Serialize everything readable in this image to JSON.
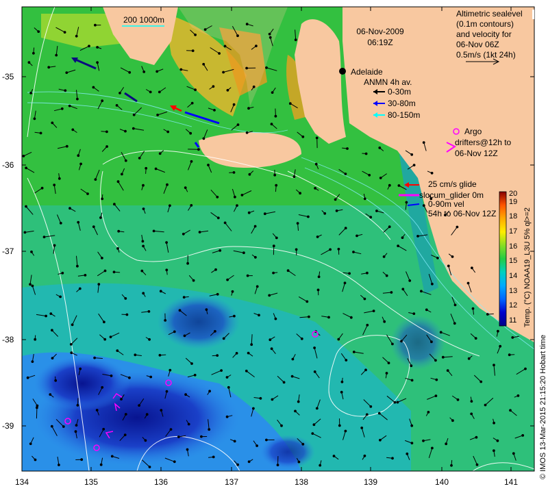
{
  "date_title": "06-Nov-2009",
  "time_title": "06:19Z",
  "city": "Adelaide",
  "scale_text": "200  1000m",
  "altimetric_legend": [
    "Altimetric sealevel",
    "(0.1m contours)",
    "and velocity for",
    "06-Nov 06Z",
    "0.5m/s (1kt 24h)"
  ],
  "anmn_legend": {
    "title": "ANMN 4h av.",
    "items": [
      {
        "label": "0-30m",
        "color": "#000000"
      },
      {
        "label": "30-80m",
        "color": "#0000ff"
      },
      {
        "label": "80-150m",
        "color": "#00ffff"
      }
    ]
  },
  "argo_legend": {
    "line1": "Argo",
    "line2": "drifters@12h to",
    "line3": "06-Nov 12Z",
    "color": "#ff00ff"
  },
  "glider_legend": [
    "25 cm/s glide",
    "slocum_glider 0m",
    "0-90m vel",
    "54h to 06-Nov 12Z"
  ],
  "colorbar": {
    "ticks": [
      "11",
      "12",
      "13",
      "14",
      "15",
      "16",
      "17",
      "18",
      "19",
      "20"
    ],
    "label": "Temp. (°C) NOAA19_L3U 5% ql>=2"
  },
  "credit": "© IMOS 13-Mar-2015 21:15:20 Hobart time",
  "x_ticks": [
    "134",
    "135",
    "136",
    "137",
    "138",
    "139",
    "140",
    "141"
  ],
  "y_ticks": [
    "-35",
    "-36",
    "-37",
    "-38",
    "-39"
  ],
  "colors": {
    "land": "#f8c8a0",
    "ocean_green": "#33cc44",
    "ocean_cyan": "#22c8a8",
    "ocean_blue": "#3388ee",
    "ocean_deep": "#0a1a9a"
  }
}
